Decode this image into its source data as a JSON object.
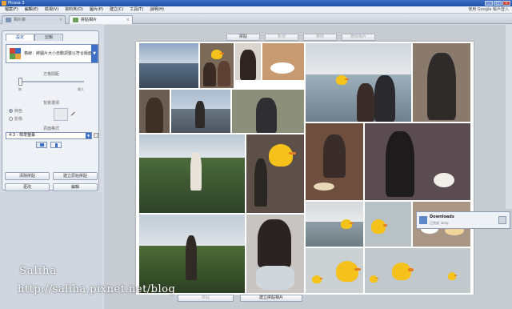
{
  "window": {
    "title": "Picasa 3"
  },
  "menu": {
    "items": [
      "檔案(F)",
      "編輯(E)",
      "檢視(V)",
      "資料夾(O)",
      "圖片(P)",
      "建立(C)",
      "工具(T)",
      "說明(H)"
    ],
    "google_link": "使用 Google 帳戶登入"
  },
  "tabs": [
    {
      "label": "相片庫",
      "active": false
    },
    {
      "label": "拼貼相片",
      "active": true
    }
  ],
  "panel": {
    "tabs": [
      "設定",
      "剪輯"
    ],
    "template_text": "格線：將圖片大小自動調整以符合版面",
    "grid_spacing_label": "方格間距",
    "slider_min": "無",
    "slider_max": "最大",
    "spacing_value": 0,
    "bg_label": "背景選項",
    "radio_color": "純色",
    "radio_image": "影像",
    "page_format_label": "頁面格式",
    "page_format_value": "4:3 - 標準螢幕",
    "buttons": [
      "清除拼貼",
      "建立原始拼貼",
      "更改",
      "編輯"
    ]
  },
  "toolbar": {
    "buttons": [
      "拼貼",
      "新增",
      "移除",
      "刪除相片"
    ]
  },
  "bottom": {
    "create_button": "建立拼貼相片",
    "disabled_button": "拼貼"
  },
  "notification": {
    "title": "Downloads",
    "subtitle": "已完成 .bmp"
  },
  "watermark": {
    "name": "Saliha",
    "url": "http://saliha.pixnet.net/blog"
  }
}
